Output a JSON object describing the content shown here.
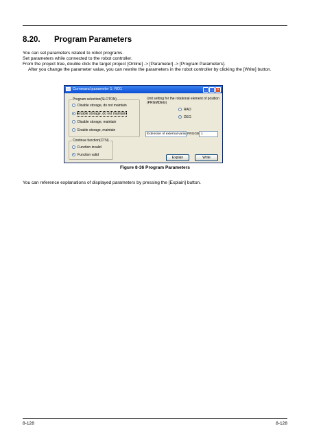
{
  "section": {
    "number": "8.20.",
    "title": "Program Parameters"
  },
  "intro_lines": [
    "You can set parameters related to robot programs.",
    "Set parameters while connected to the robot controller.",
    "From the project tree, double click the target project [Online] -> [Parameter] -> [Program Parameters].",
    "After you change the parameter value, you can rewrite the parameters in the robot controller by clicking the [Write] button."
  ],
  "dialog": {
    "title": "Command parameter 1: RO1",
    "slotdn": {
      "legend": "Program selection(SLOTON)",
      "options": [
        {
          "label": "Disable storage, do not maintain",
          "selected": false
        },
        {
          "label": "Enable storage, do not maintain",
          "selected": true
        },
        {
          "label": "Disable storage, maintain",
          "selected": false
        },
        {
          "label": "Enable storage, maintain",
          "selected": false
        }
      ]
    },
    "ctn": {
      "legend": "Continue function(CTN)",
      "options": [
        {
          "label": "Function invalid",
          "selected": false
        },
        {
          "label": "Function valid",
          "selected": true
        }
      ]
    },
    "unit": {
      "label": "Unit setting for the rotational element of position (PRGMDEG)",
      "options": [
        {
          "label": "RAD",
          "selected": false
        },
        {
          "label": "DEG",
          "selected": true
        }
      ]
    },
    "external_label": "Extension of external variable",
    "external_param": "PRGGBL",
    "external_value": "1",
    "explain_button": "Explain",
    "write_button": "Write"
  },
  "figure_caption": "Figure 8-36 Program Parameters",
  "closing_text": "You can reference explanations of displayed parameters by pressing the [Explain] button.",
  "footer": {
    "left": "8-128",
    "right": "8-128"
  }
}
